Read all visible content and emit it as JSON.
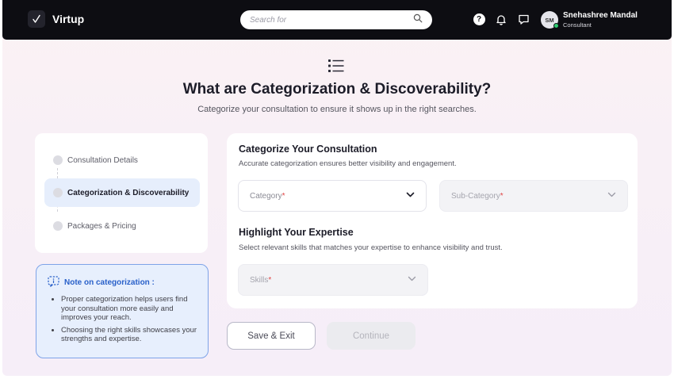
{
  "header": {
    "brand": "Virtup",
    "search_placeholder": "Search for",
    "user": {
      "initials": "SM",
      "name": "Snehashree Mandal",
      "role": "Consultant"
    }
  },
  "hero": {
    "title": "What are Categorization & Discoverability?",
    "subtitle": "Categorize your consultation to ensure it shows up in the right searches."
  },
  "steps": [
    {
      "label": "Consultation Details",
      "active": false
    },
    {
      "label": "Categorization & Discoverability",
      "active": true
    },
    {
      "label": "Packages & Pricing",
      "active": false
    }
  ],
  "note": {
    "title": "Note on categorization :",
    "points": [
      "Proper categorization helps users find your consultation more easily and improves your reach.",
      "Choosing the right skills showcases your strengths and expertise."
    ]
  },
  "categorize": {
    "title": "Categorize Your Consultation",
    "description": "Accurate categorization ensures better visibility and engagement.",
    "category_label": "Category",
    "subcategory_label": "Sub-Category",
    "required_mark": "*"
  },
  "expertise": {
    "title": "Highlight Your Expertise",
    "description": "Select relevant skills that matches your expertise to enhance visibility and trust.",
    "skills_label": "Skills"
  },
  "actions": {
    "save_exit": "Save & Exit",
    "continue": "Continue"
  },
  "colors": {
    "accent": "#2960c9",
    "header_bg": "#0d0d12",
    "active_step_bg": "#e6eefc",
    "required": "#e04545"
  }
}
